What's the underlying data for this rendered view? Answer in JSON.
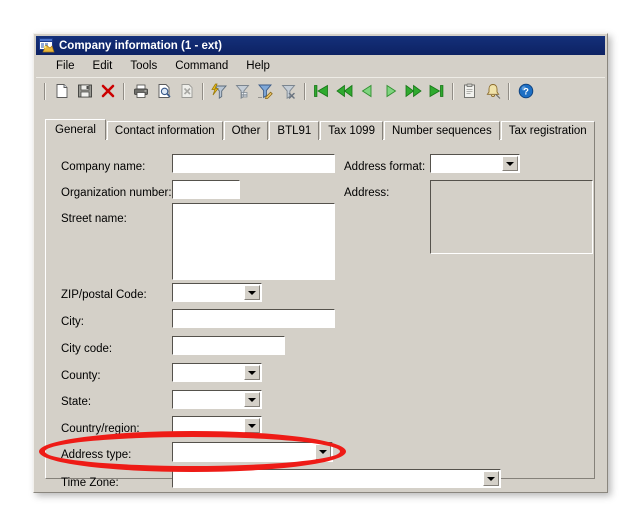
{
  "window": {
    "title": "Company information (1 - ext)",
    "icon": "company-window-icon"
  },
  "menubar": {
    "items": [
      {
        "label": "File"
      },
      {
        "label": "Edit"
      },
      {
        "label": "Tools"
      },
      {
        "label": "Command"
      },
      {
        "label": "Help"
      }
    ]
  },
  "toolbar": {
    "buttons": [
      {
        "name": "new-icon",
        "title": "New"
      },
      {
        "name": "save-icon",
        "title": "Save"
      },
      {
        "name": "delete-icon",
        "title": "Delete"
      },
      {
        "name": "print-icon",
        "title": "Print"
      },
      {
        "name": "print-preview-icon",
        "title": "Print preview"
      },
      {
        "name": "export-to-excel-icon",
        "title": "Export to Microsoft Excel"
      },
      {
        "name": "filter-by-selection-icon",
        "title": "Filter by selection"
      },
      {
        "name": "filter-by-grid-icon",
        "title": "Filter by grid"
      },
      {
        "name": "advanced-filter-icon",
        "title": "Advanced filter/sort"
      },
      {
        "name": "remove-filter-icon",
        "title": "Remove filter"
      },
      {
        "name": "go-first-icon",
        "title": "First record"
      },
      {
        "name": "go-prev-page-icon",
        "title": "Previous page"
      },
      {
        "name": "go-prev-icon",
        "title": "Previous record"
      },
      {
        "name": "go-next-icon",
        "title": "Next record"
      },
      {
        "name": "go-next-page-icon",
        "title": "Next page"
      },
      {
        "name": "go-last-icon",
        "title": "Last record"
      },
      {
        "name": "paste-icon",
        "title": "Paste"
      },
      {
        "name": "alert-icon",
        "title": "Create alert rule"
      },
      {
        "name": "help-icon",
        "title": "Help"
      }
    ]
  },
  "tabs": [
    {
      "label": "General",
      "active": true
    },
    {
      "label": "Contact information",
      "active": false
    },
    {
      "label": "Other",
      "active": false
    },
    {
      "label": "BTL91",
      "active": false
    },
    {
      "label": "Tax 1099",
      "active": false
    },
    {
      "label": "Number sequences",
      "active": false
    },
    {
      "label": "Tax registration",
      "active": false
    }
  ],
  "form": {
    "company_name": {
      "label": "Company name:",
      "value": "",
      "placeholder": ""
    },
    "organization_number": {
      "label": "Organization number:",
      "value": "",
      "placeholder": ""
    },
    "street_name": {
      "label": "Street name:",
      "value": "",
      "placeholder": ""
    },
    "zip_postal_code": {
      "label": "ZIP/postal Code:",
      "value": "",
      "placeholder": ""
    },
    "city": {
      "label": "City:",
      "value": "",
      "placeholder": ""
    },
    "city_code": {
      "label": "City code:",
      "value": "",
      "placeholder": ""
    },
    "county": {
      "label": "County:",
      "value": "",
      "placeholder": ""
    },
    "state": {
      "label": "State:",
      "value": "",
      "placeholder": ""
    },
    "country_region": {
      "label": "Country/region:",
      "value": "",
      "placeholder": ""
    },
    "address_type": {
      "label": "Address type:",
      "value": "",
      "placeholder": ""
    },
    "time_zone": {
      "label": "Time Zone:",
      "value": "",
      "placeholder": ""
    },
    "address_format": {
      "label": "Address format:",
      "value": "",
      "placeholder": ""
    },
    "address": {
      "label": "Address:",
      "value": "",
      "placeholder": ""
    }
  },
  "annotation": {
    "highlight_color": "#ee1b16",
    "highlight_target": "address-type-row"
  },
  "colors": {
    "titlebar": "#0f2667",
    "window_face": "#d4d0c8",
    "field_background": "#ffffff",
    "disabled_background": "#d4d0c8",
    "text": "#000000"
  }
}
